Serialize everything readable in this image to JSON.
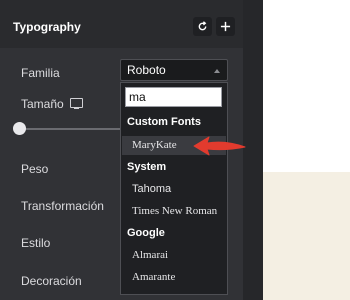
{
  "panel": {
    "title": "Typography",
    "reset_icon": "reset-icon",
    "add_icon": "plus-icon"
  },
  "labels": {
    "familia": "Familia",
    "tamano": "Tamaño",
    "peso": "Peso",
    "transformacion": "Transformación",
    "estilo": "Estilo",
    "decoracion": "Decoración"
  },
  "font_select": {
    "value": "Roboto"
  },
  "dropdown": {
    "search_value": "ma",
    "groups": [
      {
        "label": "Custom Fonts",
        "options": [
          "MaryKate"
        ]
      },
      {
        "label": "System",
        "options": [
          "Tahoma",
          "Times New Roman"
        ]
      },
      {
        "label": "Google",
        "options": [
          "Almarai",
          "Amarante"
        ]
      }
    ]
  },
  "colors": {
    "panel_bg": "#313236",
    "dropdown_bg": "#1f2023",
    "annotation_arrow": "#e23b2e"
  }
}
